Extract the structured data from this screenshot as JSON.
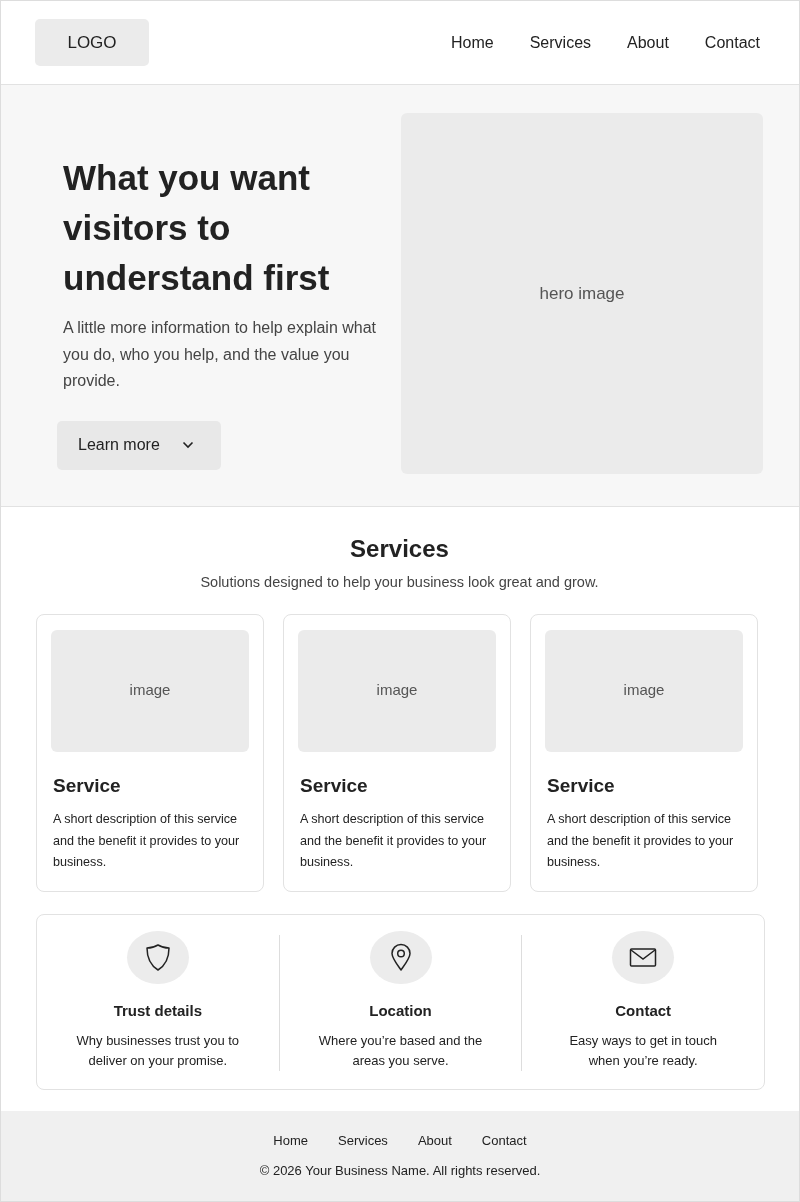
{
  "header": {
    "logo": "LOGO",
    "nav": [
      {
        "label": "Home"
      },
      {
        "label": "Services"
      },
      {
        "label": "About"
      },
      {
        "label": "Contact"
      }
    ]
  },
  "hero": {
    "title": "What you want visitors to understand first",
    "text": "A little more information to help explain what you do, who you help, and the value you provide.",
    "button": "Learn more",
    "image_label": "hero image"
  },
  "services": {
    "title": "Services",
    "subtitle": "Solutions designed to help your business look great and grow.",
    "cards": [
      {
        "image_label": "image",
        "title": "Service",
        "text": "A short description of this service and the benefit it provides to your business."
      },
      {
        "image_label": "image",
        "title": "Service",
        "text": "A short description of this service and the benefit it provides to your business."
      },
      {
        "image_label": "image",
        "title": "Service",
        "text": "A short description of this service and the benefit it provides to your business."
      }
    ]
  },
  "features": [
    {
      "kind": "shield",
      "title": "Trust details",
      "text": "Why businesses trust you to deliver on your promise."
    },
    {
      "kind": "pin",
      "title": "Location",
      "text": "Where you’re based and the areas you serve."
    },
    {
      "kind": "mail",
      "title": "Contact",
      "text": "Easy ways to get in touch when you’re ready."
    }
  ],
  "footer": {
    "nav": [
      {
        "label": "Home"
      },
      {
        "label": "Services"
      },
      {
        "label": "About"
      },
      {
        "label": "Contact"
      }
    ],
    "copyright": "© 2026 Your Business Name. All rights reserved."
  }
}
